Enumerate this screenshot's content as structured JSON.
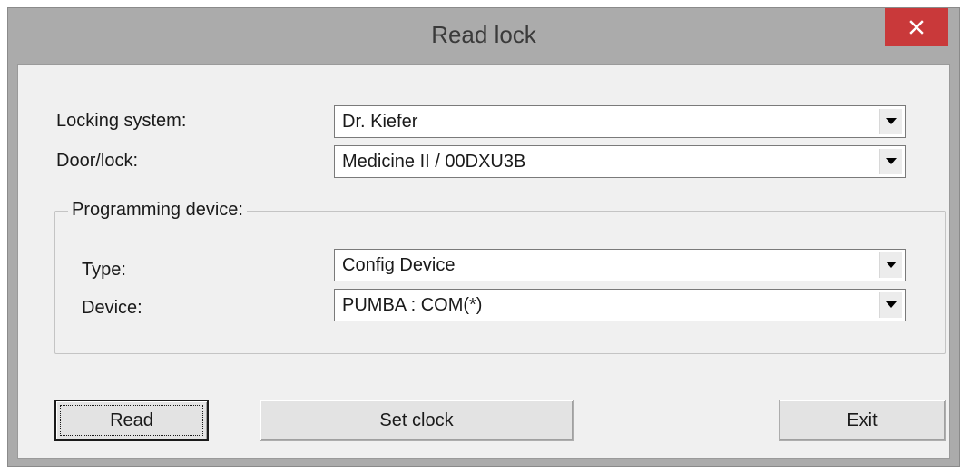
{
  "window": {
    "title": "Read lock",
    "close_icon": "close-icon"
  },
  "form": {
    "locking_system": {
      "label": "Locking system:",
      "value": "Dr. Kiefer"
    },
    "door_lock": {
      "label": "Door/lock:",
      "value": "Medicine II / 00DXU3B"
    }
  },
  "programming_device": {
    "legend": "Programming device:",
    "type": {
      "label": "Type:",
      "value": "Config Device"
    },
    "device": {
      "label": "Device:",
      "value": "PUMBA : COM(*)"
    }
  },
  "buttons": {
    "read": "Read",
    "set_clock": "Set clock",
    "exit": "Exit"
  },
  "colors": {
    "close_button": "#c9393a",
    "dialog_background": "#f0f0f0",
    "frame": "#ababab"
  }
}
